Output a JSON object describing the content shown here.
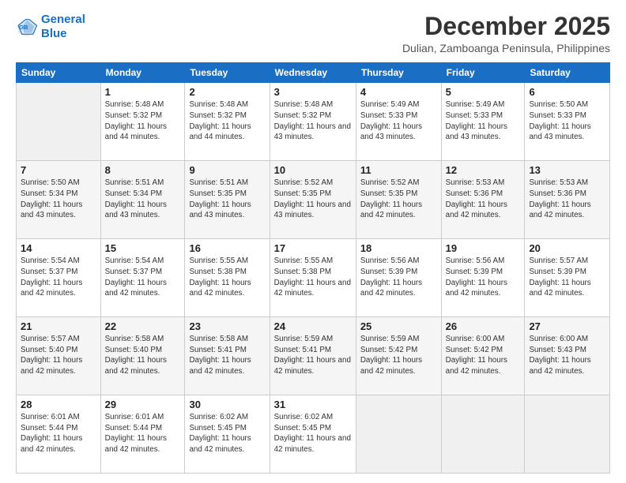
{
  "logo": {
    "line1": "General",
    "line2": "Blue"
  },
  "header": {
    "title": "December 2025",
    "subtitle": "Dulian, Zamboanga Peninsula, Philippines"
  },
  "weekdays": [
    "Sunday",
    "Monday",
    "Tuesday",
    "Wednesday",
    "Thursday",
    "Friday",
    "Saturday"
  ],
  "weeks": [
    [
      {
        "day": "",
        "sunrise": "",
        "sunset": "",
        "daylight": ""
      },
      {
        "day": "1",
        "sunrise": "Sunrise: 5:48 AM",
        "sunset": "Sunset: 5:32 PM",
        "daylight": "Daylight: 11 hours and 44 minutes."
      },
      {
        "day": "2",
        "sunrise": "Sunrise: 5:48 AM",
        "sunset": "Sunset: 5:32 PM",
        "daylight": "Daylight: 11 hours and 44 minutes."
      },
      {
        "day": "3",
        "sunrise": "Sunrise: 5:48 AM",
        "sunset": "Sunset: 5:32 PM",
        "daylight": "Daylight: 11 hours and 43 minutes."
      },
      {
        "day": "4",
        "sunrise": "Sunrise: 5:49 AM",
        "sunset": "Sunset: 5:33 PM",
        "daylight": "Daylight: 11 hours and 43 minutes."
      },
      {
        "day": "5",
        "sunrise": "Sunrise: 5:49 AM",
        "sunset": "Sunset: 5:33 PM",
        "daylight": "Daylight: 11 hours and 43 minutes."
      },
      {
        "day": "6",
        "sunrise": "Sunrise: 5:50 AM",
        "sunset": "Sunset: 5:33 PM",
        "daylight": "Daylight: 11 hours and 43 minutes."
      }
    ],
    [
      {
        "day": "7",
        "sunrise": "Sunrise: 5:50 AM",
        "sunset": "Sunset: 5:34 PM",
        "daylight": "Daylight: 11 hours and 43 minutes."
      },
      {
        "day": "8",
        "sunrise": "Sunrise: 5:51 AM",
        "sunset": "Sunset: 5:34 PM",
        "daylight": "Daylight: 11 hours and 43 minutes."
      },
      {
        "day": "9",
        "sunrise": "Sunrise: 5:51 AM",
        "sunset": "Sunset: 5:35 PM",
        "daylight": "Daylight: 11 hours and 43 minutes."
      },
      {
        "day": "10",
        "sunrise": "Sunrise: 5:52 AM",
        "sunset": "Sunset: 5:35 PM",
        "daylight": "Daylight: 11 hours and 43 minutes."
      },
      {
        "day": "11",
        "sunrise": "Sunrise: 5:52 AM",
        "sunset": "Sunset: 5:35 PM",
        "daylight": "Daylight: 11 hours and 42 minutes."
      },
      {
        "day": "12",
        "sunrise": "Sunrise: 5:53 AM",
        "sunset": "Sunset: 5:36 PM",
        "daylight": "Daylight: 11 hours and 42 minutes."
      },
      {
        "day": "13",
        "sunrise": "Sunrise: 5:53 AM",
        "sunset": "Sunset: 5:36 PM",
        "daylight": "Daylight: 11 hours and 42 minutes."
      }
    ],
    [
      {
        "day": "14",
        "sunrise": "Sunrise: 5:54 AM",
        "sunset": "Sunset: 5:37 PM",
        "daylight": "Daylight: 11 hours and 42 minutes."
      },
      {
        "day": "15",
        "sunrise": "Sunrise: 5:54 AM",
        "sunset": "Sunset: 5:37 PM",
        "daylight": "Daylight: 11 hours and 42 minutes."
      },
      {
        "day": "16",
        "sunrise": "Sunrise: 5:55 AM",
        "sunset": "Sunset: 5:38 PM",
        "daylight": "Daylight: 11 hours and 42 minutes."
      },
      {
        "day": "17",
        "sunrise": "Sunrise: 5:55 AM",
        "sunset": "Sunset: 5:38 PM",
        "daylight": "Daylight: 11 hours and 42 minutes."
      },
      {
        "day": "18",
        "sunrise": "Sunrise: 5:56 AM",
        "sunset": "Sunset: 5:39 PM",
        "daylight": "Daylight: 11 hours and 42 minutes."
      },
      {
        "day": "19",
        "sunrise": "Sunrise: 5:56 AM",
        "sunset": "Sunset: 5:39 PM",
        "daylight": "Daylight: 11 hours and 42 minutes."
      },
      {
        "day": "20",
        "sunrise": "Sunrise: 5:57 AM",
        "sunset": "Sunset: 5:39 PM",
        "daylight": "Daylight: 11 hours and 42 minutes."
      }
    ],
    [
      {
        "day": "21",
        "sunrise": "Sunrise: 5:57 AM",
        "sunset": "Sunset: 5:40 PM",
        "daylight": "Daylight: 11 hours and 42 minutes."
      },
      {
        "day": "22",
        "sunrise": "Sunrise: 5:58 AM",
        "sunset": "Sunset: 5:40 PM",
        "daylight": "Daylight: 11 hours and 42 minutes."
      },
      {
        "day": "23",
        "sunrise": "Sunrise: 5:58 AM",
        "sunset": "Sunset: 5:41 PM",
        "daylight": "Daylight: 11 hours and 42 minutes."
      },
      {
        "day": "24",
        "sunrise": "Sunrise: 5:59 AM",
        "sunset": "Sunset: 5:41 PM",
        "daylight": "Daylight: 11 hours and 42 minutes."
      },
      {
        "day": "25",
        "sunrise": "Sunrise: 5:59 AM",
        "sunset": "Sunset: 5:42 PM",
        "daylight": "Daylight: 11 hours and 42 minutes."
      },
      {
        "day": "26",
        "sunrise": "Sunrise: 6:00 AM",
        "sunset": "Sunset: 5:42 PM",
        "daylight": "Daylight: 11 hours and 42 minutes."
      },
      {
        "day": "27",
        "sunrise": "Sunrise: 6:00 AM",
        "sunset": "Sunset: 5:43 PM",
        "daylight": "Daylight: 11 hours and 42 minutes."
      }
    ],
    [
      {
        "day": "28",
        "sunrise": "Sunrise: 6:01 AM",
        "sunset": "Sunset: 5:44 PM",
        "daylight": "Daylight: 11 hours and 42 minutes."
      },
      {
        "day": "29",
        "sunrise": "Sunrise: 6:01 AM",
        "sunset": "Sunset: 5:44 PM",
        "daylight": "Daylight: 11 hours and 42 minutes."
      },
      {
        "day": "30",
        "sunrise": "Sunrise: 6:02 AM",
        "sunset": "Sunset: 5:45 PM",
        "daylight": "Daylight: 11 hours and 42 minutes."
      },
      {
        "day": "31",
        "sunrise": "Sunrise: 6:02 AM",
        "sunset": "Sunset: 5:45 PM",
        "daylight": "Daylight: 11 hours and 42 minutes."
      },
      {
        "day": "",
        "sunrise": "",
        "sunset": "",
        "daylight": ""
      },
      {
        "day": "",
        "sunrise": "",
        "sunset": "",
        "daylight": ""
      },
      {
        "day": "",
        "sunrise": "",
        "sunset": "",
        "daylight": ""
      }
    ]
  ]
}
